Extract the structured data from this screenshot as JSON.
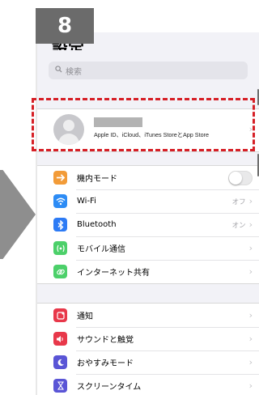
{
  "step": {
    "number": "8"
  },
  "header": {
    "title": "設定"
  },
  "search": {
    "placeholder": "検索",
    "icon": "search-icon"
  },
  "account": {
    "subtitle": "Apple ID、iCloud、iTunes StoreとApp Store"
  },
  "groups": [
    {
      "items": [
        {
          "label": "機内モード",
          "icon": "airplane-icon",
          "color": "#f29b38",
          "toggle": "off"
        },
        {
          "label": "Wi-Fi",
          "icon": "wifi-icon",
          "color": "#2d8cf5",
          "value": "オフ"
        },
        {
          "label": "Bluetooth",
          "icon": "bluetooth-icon",
          "color": "#2d7bf5",
          "value": "オン"
        },
        {
          "label": "モバイル通信",
          "icon": "antenna-icon",
          "color": "#4cd06a"
        },
        {
          "label": "インターネット共有",
          "icon": "link-icon",
          "color": "#4cd06a"
        }
      ]
    },
    {
      "items": [
        {
          "label": "通知",
          "icon": "notification-icon",
          "color": "#e8384a"
        },
        {
          "label": "サウンドと触覚",
          "icon": "speaker-icon",
          "color": "#e8384a"
        },
        {
          "label": "おやすみモード",
          "icon": "moon-icon",
          "color": "#5a55d6"
        },
        {
          "label": "スクリーンタイム",
          "icon": "hourglass-icon",
          "color": "#5a55d6"
        }
      ]
    }
  ],
  "colors": {
    "highlight": "#d61f26",
    "badge": "#6b6b6b",
    "arrow": "#8e8e8e"
  }
}
